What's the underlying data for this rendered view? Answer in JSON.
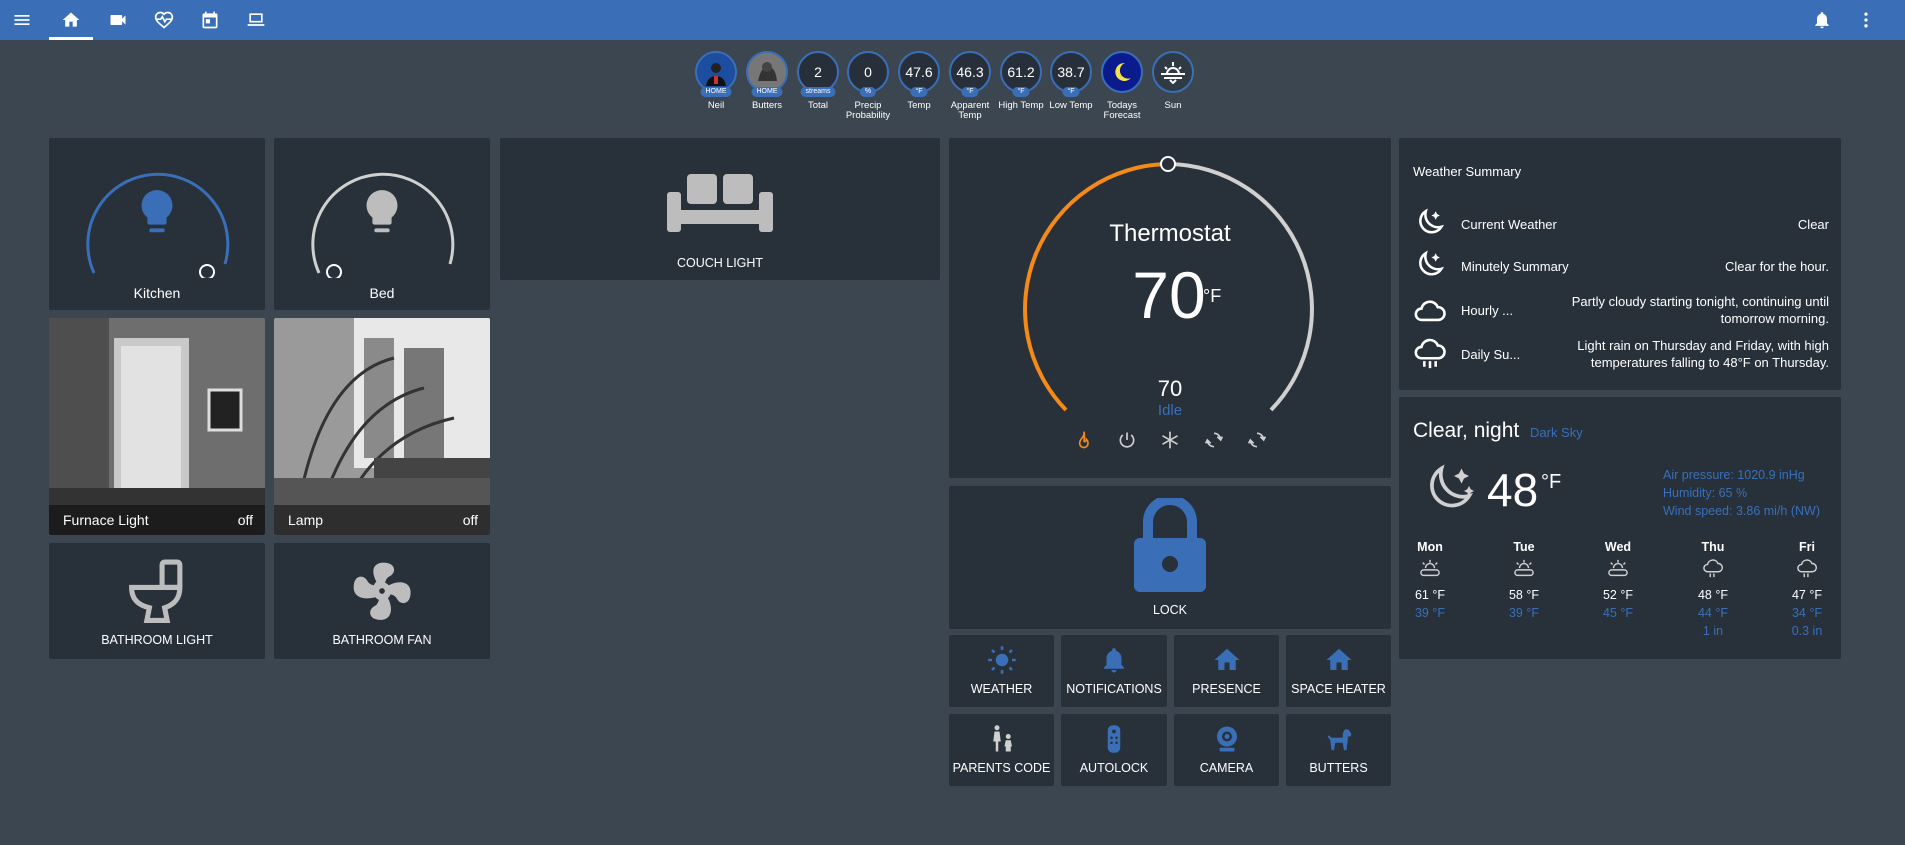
{
  "topbar": {
    "icons": [
      "menu-icon",
      "home-icon",
      "video-icon",
      "heart-pulse-icon",
      "calendar-icon",
      "laptop-icon",
      "bell-icon",
      "more-vert-icon"
    ]
  },
  "badges": [
    {
      "label": "Neil",
      "unit": "HOME",
      "type": "avatar"
    },
    {
      "label": "Butters",
      "unit": "HOME",
      "type": "avatar"
    },
    {
      "label": "Total",
      "value": "2",
      "unit": "streams"
    },
    {
      "label": "Precip Probability",
      "value": "0",
      "unit": "%"
    },
    {
      "label": "Temp",
      "value": "47.6",
      "unit": "°F"
    },
    {
      "label": "Apparent Temp",
      "value": "46.3",
      "unit": "°F"
    },
    {
      "label": "High Temp",
      "value": "61.2",
      "unit": "°F"
    },
    {
      "label": "Low Temp",
      "value": "38.7",
      "unit": "°F"
    },
    {
      "label": "Todays Forecast",
      "type": "moon"
    },
    {
      "label": "Sun",
      "type": "sun"
    }
  ],
  "lights": {
    "kitchen": "Kitchen",
    "bed": "Bed",
    "couch": "COUCH LIGHT",
    "furnace": {
      "name": "Furnace Light",
      "state": "off"
    },
    "lamp": {
      "name": "Lamp",
      "state": "off"
    },
    "bathroom_light": "BATHROOM LIGHT",
    "bathroom_fan": "BATHROOM FAN"
  },
  "thermostat": {
    "title": "Thermostat",
    "target": "70",
    "unit": "°F",
    "current": "70",
    "state": "Idle"
  },
  "lock": {
    "label": "LOCK"
  },
  "buttons": [
    {
      "label": "WEATHER",
      "icon": "weather-sunny-icon"
    },
    {
      "label": "NOTIFICATIONS",
      "icon": "bell-icon"
    },
    {
      "label": "PRESENCE",
      "icon": "home-icon"
    },
    {
      "label": "SPACE HEATER",
      "icon": "home-icon"
    },
    {
      "label": "PARENTS CODE",
      "icon": "human-child-icon"
    },
    {
      "label": "AUTOLOCK",
      "icon": "remote-icon"
    },
    {
      "label": "CAMERA",
      "icon": "webcam-icon"
    },
    {
      "label": "BUTTERS",
      "icon": "dog-icon"
    }
  ],
  "weather_summary": {
    "title": "Weather Summary",
    "rows": [
      {
        "name": "Current Weather",
        "value": "Clear"
      },
      {
        "name": "Minutely Summary",
        "value": "Clear for the hour."
      },
      {
        "name": "Hourly ...",
        "value": "Partly cloudy starting tonight, continuing until tomorrow morning."
      },
      {
        "name": "Daily Su...",
        "value": "Light rain on Thursday and Friday, with high temperatures falling to 48°F on Thursday."
      }
    ]
  },
  "forecast": {
    "condition": "Clear, night",
    "source": "Dark Sky",
    "temp": "48",
    "unit": "°F",
    "pressure": "Air pressure: 1020.9 inHg",
    "humidity": "Humidity: 65 %",
    "wind": "Wind speed: 3.86 mi/h (NW)",
    "days": [
      {
        "day": "Mon",
        "high": "61 °F",
        "low": "39 °F",
        "precip": ""
      },
      {
        "day": "Tue",
        "high": "58 °F",
        "low": "39 °F",
        "precip": ""
      },
      {
        "day": "Wed",
        "high": "52 °F",
        "low": "45 °F",
        "precip": ""
      },
      {
        "day": "Thu",
        "high": "48 °F",
        "low": "44 °F",
        "precip": "1 in"
      },
      {
        "day": "Fri",
        "high": "47 °F",
        "low": "34 °F",
        "precip": "0.3 in"
      }
    ]
  },
  "colors": {
    "accent": "#3a6fb8",
    "heat": "#f48a17",
    "card": "#28313a",
    "background": "#3b4650"
  }
}
